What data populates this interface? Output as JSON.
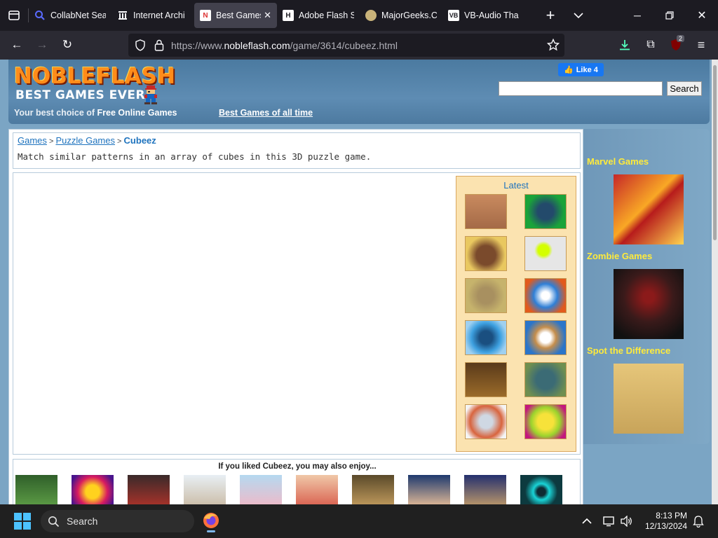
{
  "browser": {
    "tabs": [
      {
        "label": "CollabNet Sea",
        "favicon": "search-favicon",
        "active": false
      },
      {
        "label": "Internet Archi",
        "favicon": "archive-favicon",
        "active": false
      },
      {
        "label": "Best Games",
        "favicon": "nobleflash-favicon",
        "active": true
      },
      {
        "label": "Adobe Flash S",
        "favicon": "h-favicon",
        "active": false
      },
      {
        "label": "MajorGeeks.C",
        "favicon": "majorgeeks-favicon",
        "active": false
      },
      {
        "label": "VB-Audio Tha",
        "favicon": "vb-favicon",
        "active": false
      }
    ],
    "url_prefix": "https://www.",
    "url_domain": "nobleflash.com",
    "url_path": "/game/3614/cubeez.html",
    "extension_badge": "2"
  },
  "site": {
    "logo": "NOBLEFLASH",
    "tagline": "BEST GAMES EVER",
    "subline_lead": "Your best choice of ",
    "subline_bold": "Free Online Games",
    "best_link": "Best Games of all time",
    "fb_like": "Like 4",
    "search_placeholder": "",
    "search_button": "Search"
  },
  "breadcrumb": {
    "games": "Games",
    "sep1": " > ",
    "puzzle": "Puzzle Games",
    "sep2": " > ",
    "current": "Cubeez"
  },
  "description": "Match similar patterns in an array of cubes in this 3D puzzle game.",
  "latest": {
    "title": "Latest"
  },
  "related": {
    "title": "If you liked Cubeez, you may also enjoy..."
  },
  "sidebar": {
    "sections": [
      "Marvel Games",
      "Zombie Games",
      "Spot the Difference"
    ]
  },
  "taskbar": {
    "search_label": "Search",
    "time": "8:13 PM",
    "date": "12/13/2024"
  },
  "colors": {
    "page_bg": "#7ba5c4",
    "sidebar_heading": "#ffeb3b",
    "logo_orange": "#ff8c1a",
    "latest_bg": "#fbe3b0"
  }
}
